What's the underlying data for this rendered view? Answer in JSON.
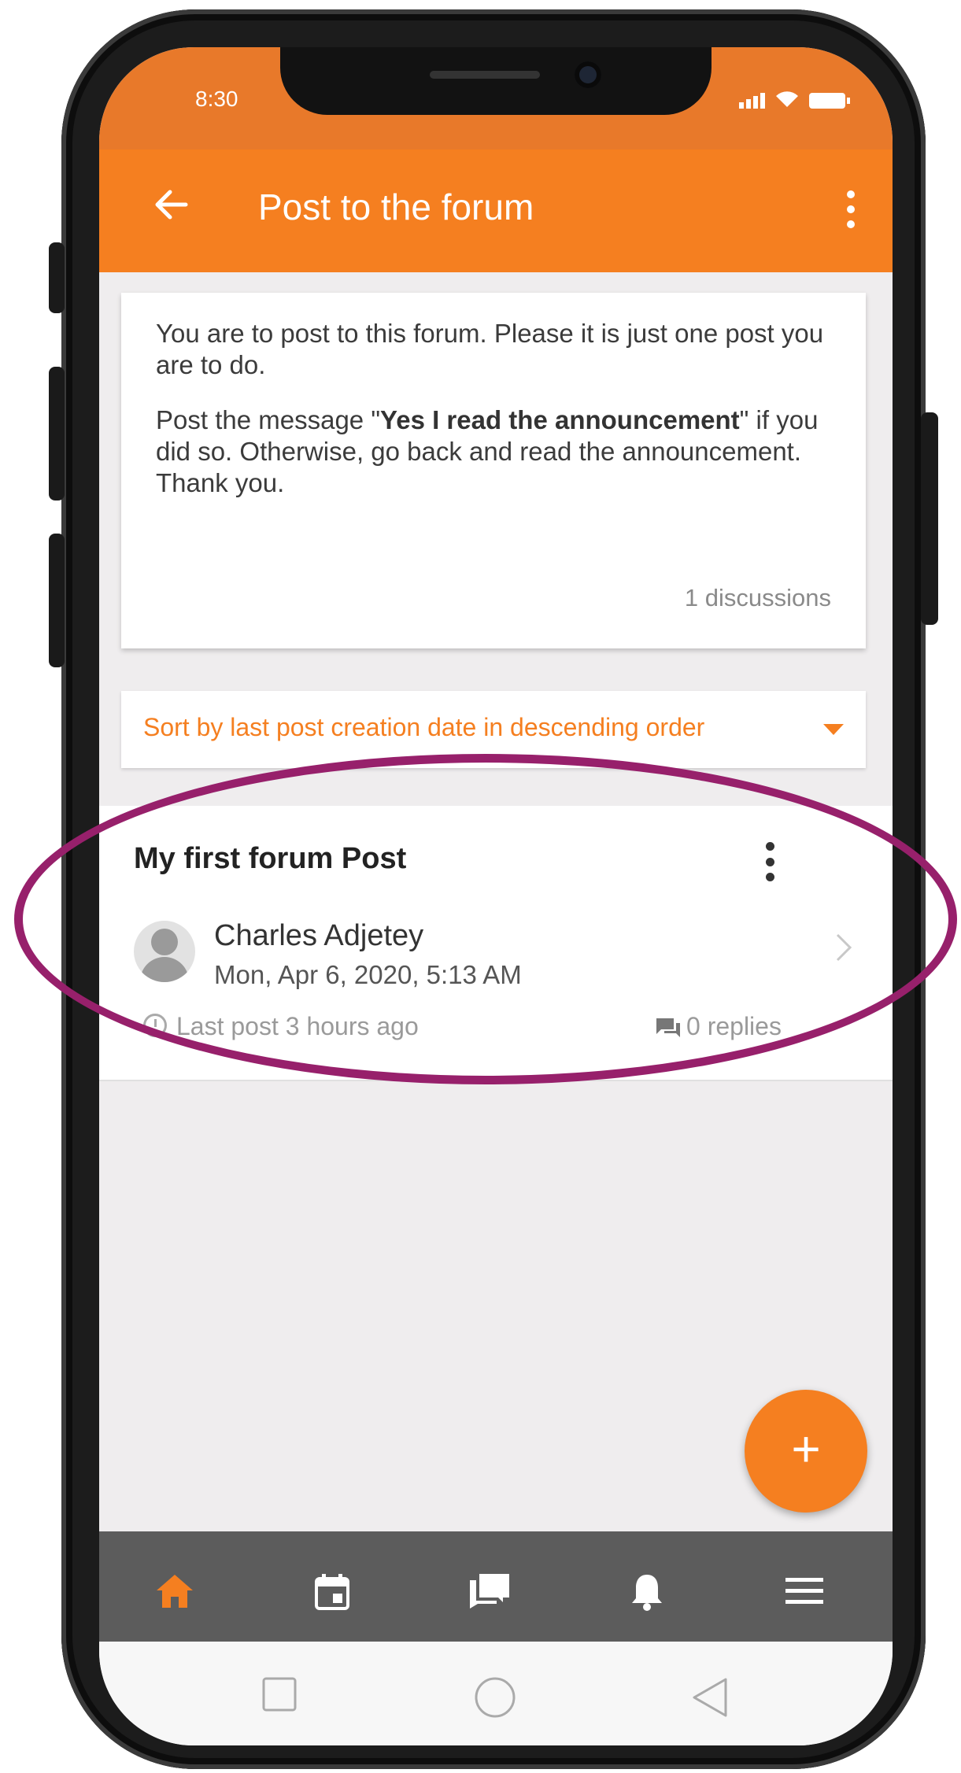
{
  "status_bar": {
    "time": "8:30"
  },
  "app_bar": {
    "title": "Post to the forum"
  },
  "intro_card": {
    "p1": "You are to post to this forum. Please it is just one post you are to do.",
    "p2_before": "Post the message \"",
    "p2_bold": "Yes I read the announcement",
    "p2_after": "\" if you did so. Otherwise, go back and read the announcement. Thank you.",
    "discussions": "1 discussions"
  },
  "sort": {
    "label": "Sort by last post creation date in descending order"
  },
  "post": {
    "title": "My first forum Post",
    "author": "Charles Adjetey",
    "date": "Mon, Apr 6, 2020, 5:13 AM",
    "last_post": "Last post 3 hours ago",
    "replies": "0 replies"
  },
  "fab": {
    "symbol": "+"
  },
  "bottom_nav": {
    "items": [
      "home-icon",
      "calendar-icon",
      "forum-icon",
      "notifications-icon",
      "menu-icon"
    ],
    "active": "home-icon"
  },
  "colors": {
    "accent": "#f57f20",
    "status_bar": "#e8792a",
    "highlight": "#97206b",
    "nav_bg": "#5c5c5c"
  }
}
